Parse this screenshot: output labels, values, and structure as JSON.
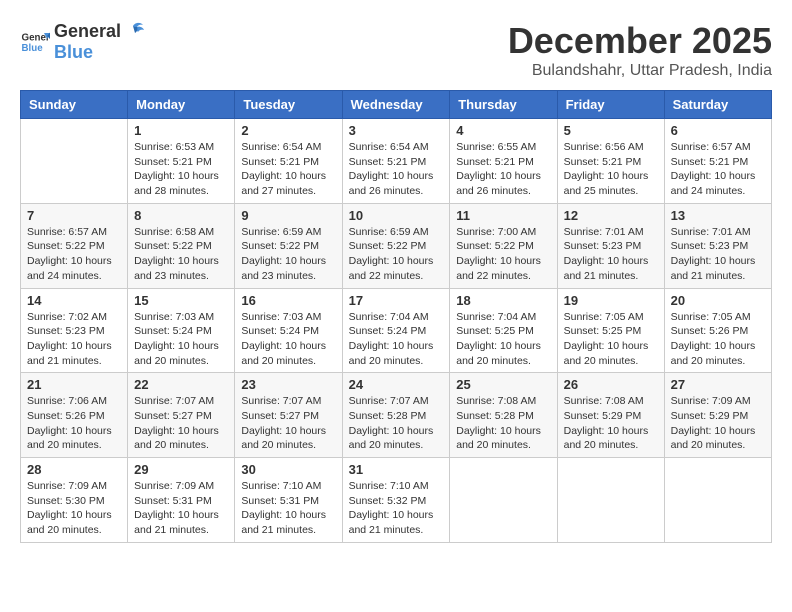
{
  "header": {
    "logo": {
      "text_general": "General",
      "text_blue": "Blue"
    },
    "month": "December 2025",
    "location": "Bulandshahr, Uttar Pradesh, India"
  },
  "calendar": {
    "headers": [
      "Sunday",
      "Monday",
      "Tuesday",
      "Wednesday",
      "Thursday",
      "Friday",
      "Saturday"
    ],
    "weeks": [
      [
        {
          "day": "",
          "info": ""
        },
        {
          "day": "1",
          "info": "Sunrise: 6:53 AM\nSunset: 5:21 PM\nDaylight: 10 hours\nand 28 minutes."
        },
        {
          "day": "2",
          "info": "Sunrise: 6:54 AM\nSunset: 5:21 PM\nDaylight: 10 hours\nand 27 minutes."
        },
        {
          "day": "3",
          "info": "Sunrise: 6:54 AM\nSunset: 5:21 PM\nDaylight: 10 hours\nand 26 minutes."
        },
        {
          "day": "4",
          "info": "Sunrise: 6:55 AM\nSunset: 5:21 PM\nDaylight: 10 hours\nand 26 minutes."
        },
        {
          "day": "5",
          "info": "Sunrise: 6:56 AM\nSunset: 5:21 PM\nDaylight: 10 hours\nand 25 minutes."
        },
        {
          "day": "6",
          "info": "Sunrise: 6:57 AM\nSunset: 5:21 PM\nDaylight: 10 hours\nand 24 minutes."
        }
      ],
      [
        {
          "day": "7",
          "info": "Sunrise: 6:57 AM\nSunset: 5:22 PM\nDaylight: 10 hours\nand 24 minutes."
        },
        {
          "day": "8",
          "info": "Sunrise: 6:58 AM\nSunset: 5:22 PM\nDaylight: 10 hours\nand 23 minutes."
        },
        {
          "day": "9",
          "info": "Sunrise: 6:59 AM\nSunset: 5:22 PM\nDaylight: 10 hours\nand 23 minutes."
        },
        {
          "day": "10",
          "info": "Sunrise: 6:59 AM\nSunset: 5:22 PM\nDaylight: 10 hours\nand 22 minutes."
        },
        {
          "day": "11",
          "info": "Sunrise: 7:00 AM\nSunset: 5:22 PM\nDaylight: 10 hours\nand 22 minutes."
        },
        {
          "day": "12",
          "info": "Sunrise: 7:01 AM\nSunset: 5:23 PM\nDaylight: 10 hours\nand 21 minutes."
        },
        {
          "day": "13",
          "info": "Sunrise: 7:01 AM\nSunset: 5:23 PM\nDaylight: 10 hours\nand 21 minutes."
        }
      ],
      [
        {
          "day": "14",
          "info": "Sunrise: 7:02 AM\nSunset: 5:23 PM\nDaylight: 10 hours\nand 21 minutes."
        },
        {
          "day": "15",
          "info": "Sunrise: 7:03 AM\nSunset: 5:24 PM\nDaylight: 10 hours\nand 20 minutes."
        },
        {
          "day": "16",
          "info": "Sunrise: 7:03 AM\nSunset: 5:24 PM\nDaylight: 10 hours\nand 20 minutes."
        },
        {
          "day": "17",
          "info": "Sunrise: 7:04 AM\nSunset: 5:24 PM\nDaylight: 10 hours\nand 20 minutes."
        },
        {
          "day": "18",
          "info": "Sunrise: 7:04 AM\nSunset: 5:25 PM\nDaylight: 10 hours\nand 20 minutes."
        },
        {
          "day": "19",
          "info": "Sunrise: 7:05 AM\nSunset: 5:25 PM\nDaylight: 10 hours\nand 20 minutes."
        },
        {
          "day": "20",
          "info": "Sunrise: 7:05 AM\nSunset: 5:26 PM\nDaylight: 10 hours\nand 20 minutes."
        }
      ],
      [
        {
          "day": "21",
          "info": "Sunrise: 7:06 AM\nSunset: 5:26 PM\nDaylight: 10 hours\nand 20 minutes."
        },
        {
          "day": "22",
          "info": "Sunrise: 7:07 AM\nSunset: 5:27 PM\nDaylight: 10 hours\nand 20 minutes."
        },
        {
          "day": "23",
          "info": "Sunrise: 7:07 AM\nSunset: 5:27 PM\nDaylight: 10 hours\nand 20 minutes."
        },
        {
          "day": "24",
          "info": "Sunrise: 7:07 AM\nSunset: 5:28 PM\nDaylight: 10 hours\nand 20 minutes."
        },
        {
          "day": "25",
          "info": "Sunrise: 7:08 AM\nSunset: 5:28 PM\nDaylight: 10 hours\nand 20 minutes."
        },
        {
          "day": "26",
          "info": "Sunrise: 7:08 AM\nSunset: 5:29 PM\nDaylight: 10 hours\nand 20 minutes."
        },
        {
          "day": "27",
          "info": "Sunrise: 7:09 AM\nSunset: 5:29 PM\nDaylight: 10 hours\nand 20 minutes."
        }
      ],
      [
        {
          "day": "28",
          "info": "Sunrise: 7:09 AM\nSunset: 5:30 PM\nDaylight: 10 hours\nand 20 minutes."
        },
        {
          "day": "29",
          "info": "Sunrise: 7:09 AM\nSunset: 5:31 PM\nDaylight: 10 hours\nand 21 minutes."
        },
        {
          "day": "30",
          "info": "Sunrise: 7:10 AM\nSunset: 5:31 PM\nDaylight: 10 hours\nand 21 minutes."
        },
        {
          "day": "31",
          "info": "Sunrise: 7:10 AM\nSunset: 5:32 PM\nDaylight: 10 hours\nand 21 minutes."
        },
        {
          "day": "",
          "info": ""
        },
        {
          "day": "",
          "info": ""
        },
        {
          "day": "",
          "info": ""
        }
      ]
    ]
  }
}
